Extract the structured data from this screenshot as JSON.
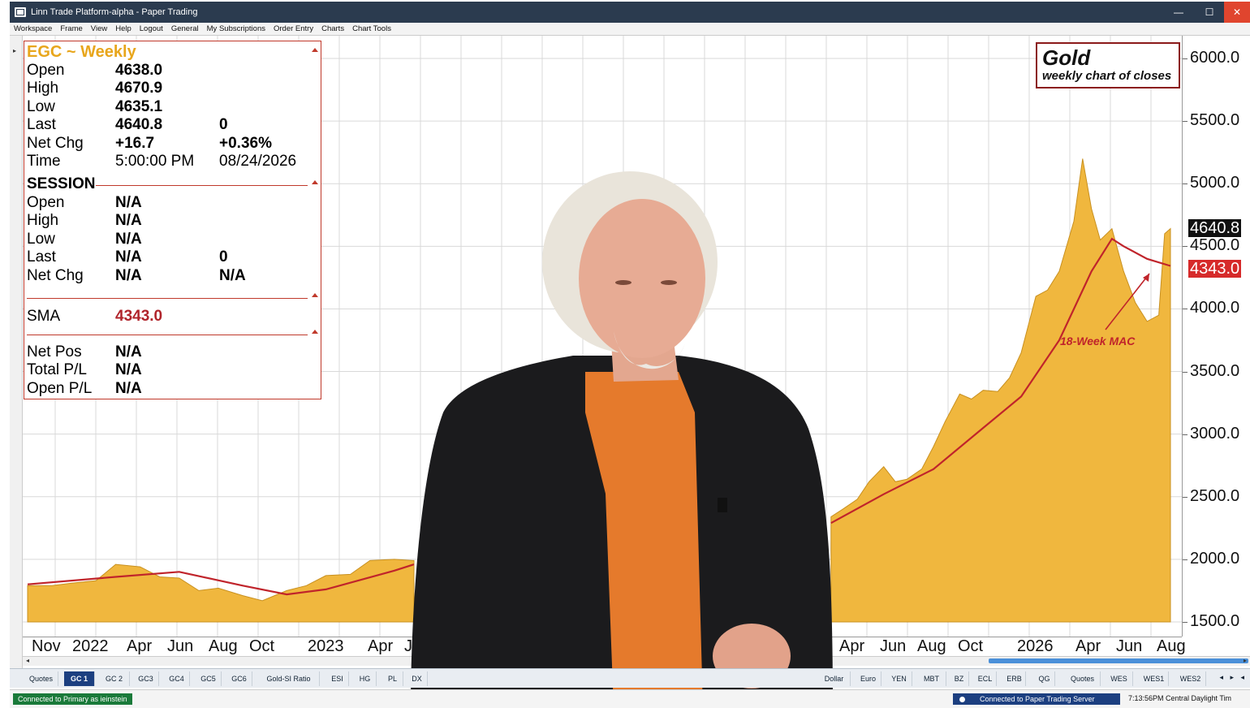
{
  "window": {
    "title": "Linn Trade Platform-alpha - Paper Trading",
    "controls": [
      "—",
      "☐",
      "✕"
    ]
  },
  "menu": [
    "Workspace",
    "Frame",
    "View",
    "Help",
    "Logout",
    "General",
    "My Subscriptions",
    "Order Entry",
    "Charts",
    "Chart Tools"
  ],
  "info": {
    "header": "EGC ~ Weekly",
    "quote": [
      {
        "label": "Open",
        "value": "4638.0",
        "extra": ""
      },
      {
        "label": "High",
        "value": "4670.9",
        "extra": ""
      },
      {
        "label": "Low",
        "value": "4635.1",
        "extra": ""
      },
      {
        "label": "Last",
        "value": "4640.8",
        "extra": "0"
      },
      {
        "label": "Net Chg",
        "value": "+16.7",
        "extra": "+0.36%"
      },
      {
        "label": "Time",
        "value": "5:00:00 PM",
        "extra": "08/24/2026"
      }
    ],
    "session_header": "SESSION",
    "session": [
      {
        "label": "Open",
        "value": "N/A",
        "extra": ""
      },
      {
        "label": "High",
        "value": "N/A",
        "extra": ""
      },
      {
        "label": "Low",
        "value": "N/A",
        "extra": ""
      },
      {
        "label": "Last",
        "value": "N/A",
        "extra": "0"
      },
      {
        "label": "Net Chg",
        "value": "N/A",
        "extra": "N/A"
      }
    ],
    "sma": {
      "label": "SMA",
      "value": "4343.0"
    },
    "positions": [
      {
        "label": "Net Pos",
        "value": "N/A"
      },
      {
        "label": "Total P/L",
        "value": "N/A"
      },
      {
        "label": "Open P/L",
        "value": "N/A"
      }
    ]
  },
  "legend": {
    "title": "Gold",
    "subtitle": "weekly chart of closes"
  },
  "annotation": "18-Week MAC",
  "price_axis": {
    "ticks": [
      "6000.0",
      "5500.0",
      "5000.0",
      "4500.0",
      "4000.0",
      "3500.0",
      "3000.0",
      "2500.0",
      "2000.0",
      "1500.0"
    ],
    "last_badge": "4640.8",
    "sma_badge": "4343.0"
  },
  "date_axis": [
    "Nov",
    "2022",
    "Apr",
    "Jun",
    "Aug",
    "Oct",
    "2023",
    "Apr",
    "Jun",
    "Apr",
    "Jun",
    "Aug",
    "Oct",
    "2026",
    "Apr",
    "Jun",
    "Aug"
  ],
  "tabs": [
    "Quotes",
    "GC 1",
    "GC 2",
    "GC3",
    "GC4",
    "GC5",
    "GC6",
    "Gold-SI Ratio",
    "ESI",
    "HG",
    "PL",
    "DX",
    "Dollar",
    "Euro",
    "YEN",
    "MBT",
    "BZ",
    "ECL",
    "ERB",
    "QG",
    "Quotes",
    "WES",
    "WES1",
    "WES2"
  ],
  "tab_nav": "◂ ▸ ◂",
  "status": {
    "left": "Connected to Primary as ieinstein",
    "right": "Connected to Paper Trading Server",
    "time": "7:13:56PM Central Daylight Tim"
  },
  "colors": {
    "area": "#f0b73e",
    "area_edge": "#c89020",
    "sma_line": "#c0242b",
    "grid": "#d9d9d9",
    "last_badge": "#111111",
    "sma_badge": "#d62a2a",
    "titlebar": "#2b3b4f"
  },
  "chart_data": {
    "type": "area",
    "title": "Gold",
    "subtitle": "weekly chart of closes",
    "instrument": "EGC ~ Weekly",
    "ylim": [
      1500,
      6000
    ],
    "yticks": [
      1500,
      2000,
      2500,
      3000,
      3500,
      4000,
      4500,
      5000,
      5500,
      6000
    ],
    "series": [
      {
        "name": "EGC",
        "kind": "area",
        "points": [
          [
            "2021-11-01",
            1790
          ],
          [
            "2021-12-06",
            1790
          ],
          [
            "2022-01-03",
            1810
          ],
          [
            "2022-02-07",
            1830
          ],
          [
            "2022-03-07",
            1960
          ],
          [
            "2022-04-11",
            1940
          ],
          [
            "2022-05-09",
            1860
          ],
          [
            "2022-06-06",
            1850
          ],
          [
            "2022-07-04",
            1750
          ],
          [
            "2022-08-01",
            1770
          ],
          [
            "2022-09-05",
            1710
          ],
          [
            "2022-10-03",
            1670
          ],
          [
            "2022-11-07",
            1750
          ],
          [
            "2022-12-05",
            1790
          ],
          [
            "2023-01-02",
            1870
          ],
          [
            "2023-02-06",
            1880
          ],
          [
            "2023-03-06",
            1990
          ],
          [
            "2023-04-10",
            2000
          ],
          [
            "2023-05-08",
            1990
          ],
          [
            "2024-06-03",
            2340
          ],
          [
            "2024-07-01",
            2400
          ],
          [
            "2024-08-05",
            2480
          ],
          [
            "2024-09-02",
            2620
          ],
          [
            "2024-10-07",
            2740
          ],
          [
            "2024-11-04",
            2620
          ],
          [
            "2024-12-02",
            2640
          ],
          [
            "2025-01-06",
            2720
          ],
          [
            "2025-02-03",
            2900
          ],
          [
            "2025-03-03",
            3100
          ],
          [
            "2025-04-07",
            3320
          ],
          [
            "2025-05-05",
            3280
          ],
          [
            "2025-06-02",
            3350
          ],
          [
            "2025-07-07",
            3340
          ],
          [
            "2025-08-04",
            3450
          ],
          [
            "2025-09-01",
            3650
          ],
          [
            "2025-10-06",
            4100
          ],
          [
            "2025-11-03",
            4150
          ],
          [
            "2025-12-01",
            4300
          ],
          [
            "2026-01-05",
            4700
          ],
          [
            "2026-01-26",
            5200
          ],
          [
            "2026-02-16",
            4800
          ],
          [
            "2026-03-09",
            4550
          ],
          [
            "2026-04-06",
            4640
          ],
          [
            "2026-05-04",
            4300
          ],
          [
            "2026-06-01",
            4050
          ],
          [
            "2026-06-29",
            3900
          ],
          [
            "2026-07-27",
            3950
          ],
          [
            "2026-08-10",
            4600
          ],
          [
            "2026-08-24",
            4640.8
          ]
        ]
      },
      {
        "name": "SMA",
        "kind": "line",
        "points": [
          [
            "2021-11-01",
            1800
          ],
          [
            "2022-03-07",
            1860
          ],
          [
            "2022-06-06",
            1900
          ],
          [
            "2022-09-05",
            1790
          ],
          [
            "2022-11-07",
            1720
          ],
          [
            "2023-01-02",
            1760
          ],
          [
            "2023-04-10",
            1910
          ],
          [
            "2023-05-08",
            1960
          ],
          [
            "2024-06-03",
            2290
          ],
          [
            "2024-10-07",
            2520
          ],
          [
            "2025-02-03",
            2720
          ],
          [
            "2025-06-02",
            3050
          ],
          [
            "2025-09-01",
            3300
          ],
          [
            "2025-12-01",
            3750
          ],
          [
            "2026-02-16",
            4300
          ],
          [
            "2026-04-06",
            4560
          ],
          [
            "2026-05-04",
            4500
          ],
          [
            "2026-06-29",
            4400
          ],
          [
            "2026-08-24",
            4343.0
          ]
        ]
      }
    ],
    "last": 4640.8,
    "sma_last": 4343.0
  }
}
